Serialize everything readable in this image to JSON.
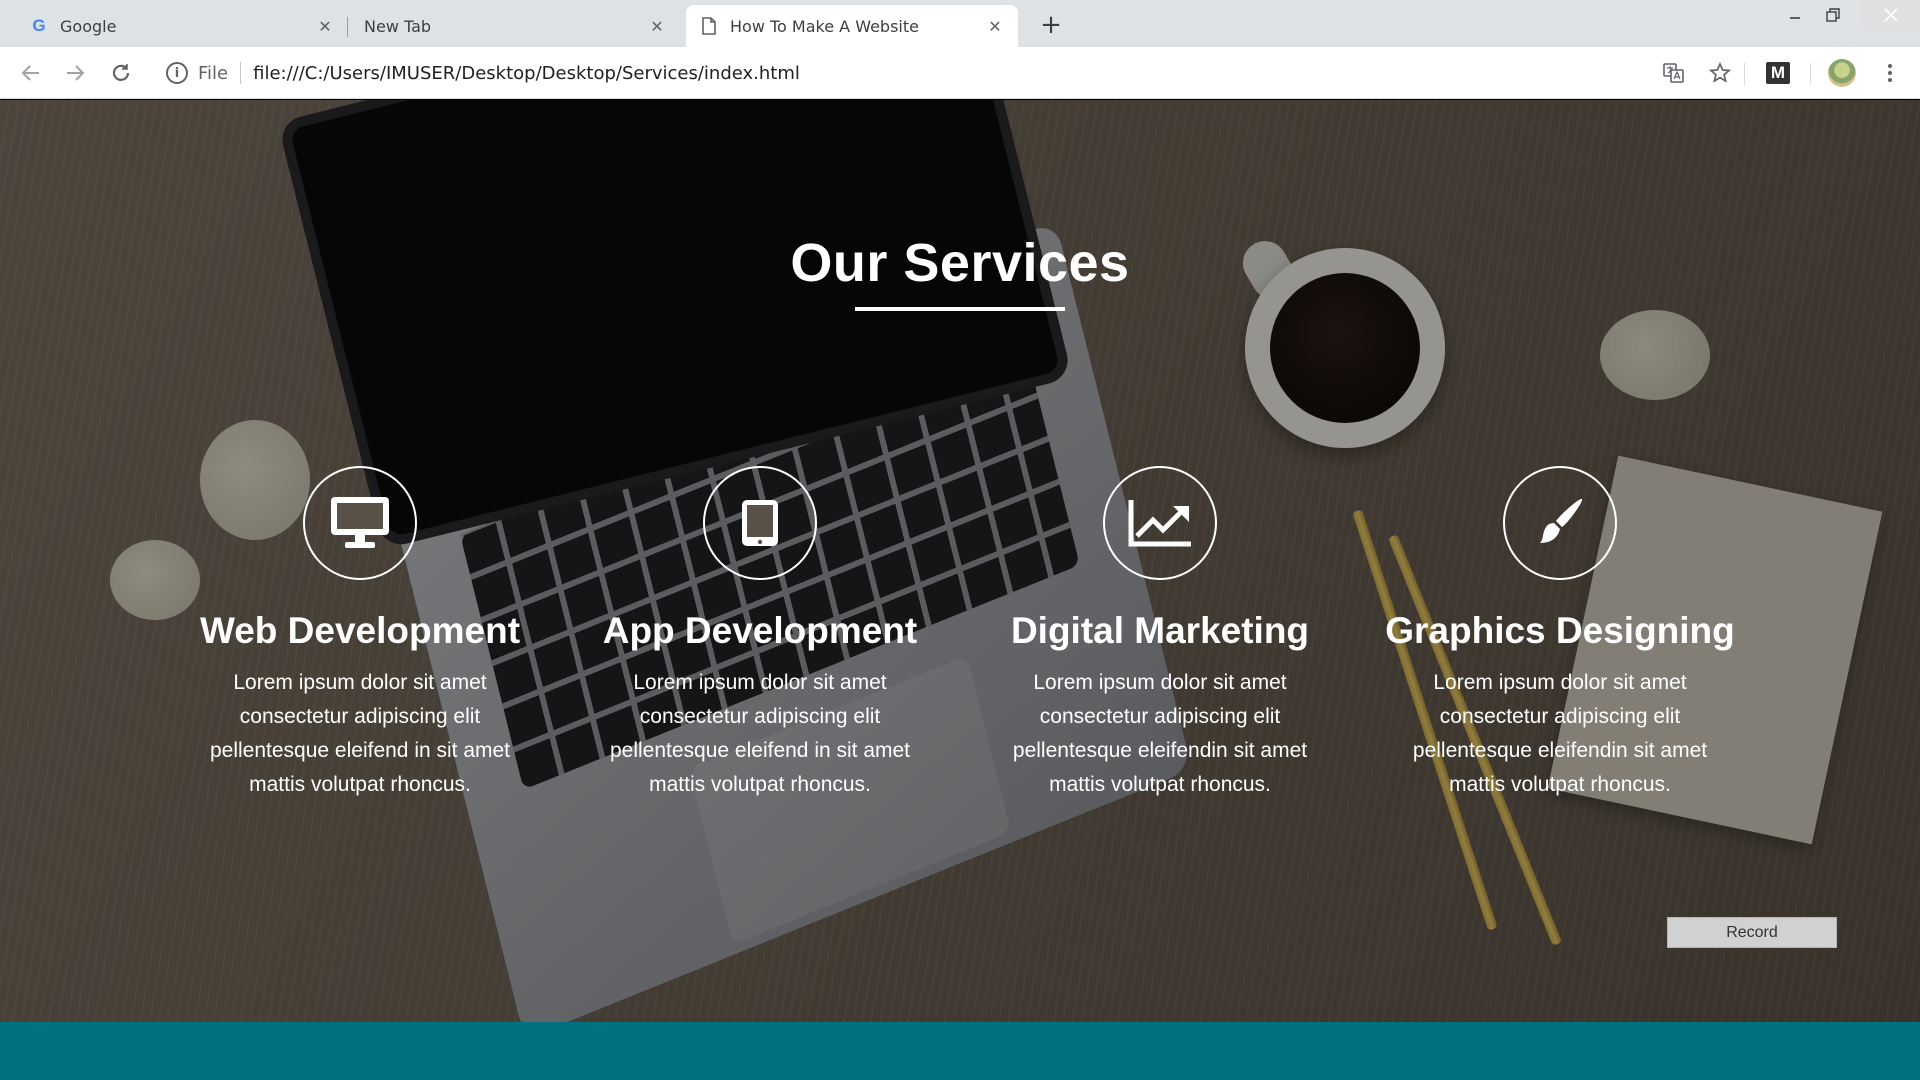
{
  "browser": {
    "tabs": [
      {
        "title": "Google",
        "favicon": "google-logo",
        "logo_letter": "G",
        "active": false
      },
      {
        "title": "New Tab",
        "favicon": "none",
        "active": false
      },
      {
        "title": "How To Make A Website",
        "favicon": "document-icon",
        "active": true
      }
    ],
    "close_glyph": "✕",
    "new_tab_glyph": "+",
    "file_label": "File",
    "url": "file:///C:/Users/IMUSER/Desktop/Desktop/Services/index.html",
    "extension_label": "M"
  },
  "page": {
    "section_title": "Our Services",
    "services": [
      {
        "title": "Web Development",
        "description": "Lorem ipsum dolor sit amet consectetur adipiscing elit pellentesque eleifend in sit amet mattis volutpat rhoncus.",
        "icon": "desktop-monitor-icon"
      },
      {
        "title": "App Development",
        "description": "Lorem ipsum dolor sit amet consectetur adipiscing elit pellentesque eleifend in sit amet mattis volutpat rhoncus.",
        "icon": "tablet-icon"
      },
      {
        "title": "Digital Marketing",
        "description": "Lorem ipsum dolor sit amet consectetur adipiscing elit pellentesque eleifendin sit amet mattis volutpat rhoncus.",
        "icon": "line-chart-icon"
      },
      {
        "title": "Graphics Designing",
        "description": "Lorem ipsum dolor sit amet consectetur adipiscing elit pellentesque eleifendin sit amet mattis volutpat rhoncus.",
        "icon": "paint-brush-icon"
      }
    ],
    "record_button": "Record"
  },
  "colors": {
    "footer_band": "#00727f",
    "tab_strip": "#dee1e6",
    "text_on_hero": "#ffffff"
  }
}
